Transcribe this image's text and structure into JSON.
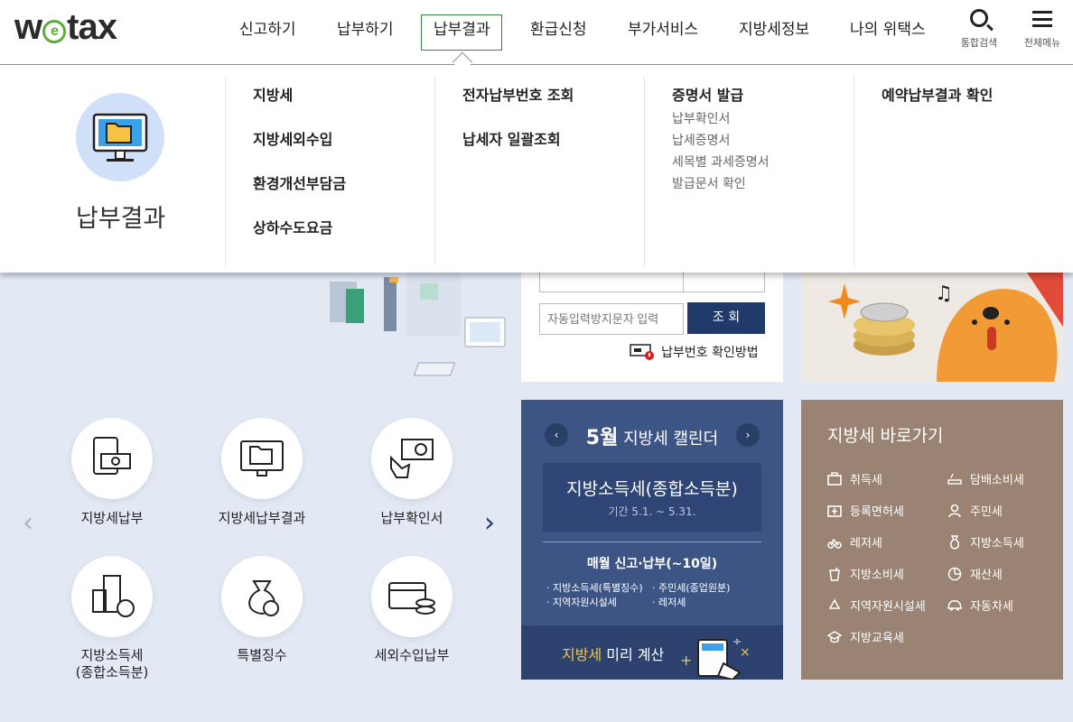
{
  "header": {
    "logo": "wetax",
    "nav": [
      "신고하기",
      "납부하기",
      "납부결과",
      "환급신청",
      "부가서비스",
      "지방세정보",
      "나의 위택스"
    ],
    "search_label": "통합검색",
    "menu_label": "전체메뉴"
  },
  "dropdown": {
    "title": "납부결과",
    "col1": [
      "지방세",
      "지방세외수입",
      "환경개선부담금",
      "상하수도요금"
    ],
    "col2": [
      "전자납부번호 조회",
      "납세자 일괄조회"
    ],
    "col3_head": "증명서 발급",
    "col3_subs": [
      "납부확인서",
      "납세증명서",
      "세목별 과세증명서",
      "발급문서 확인"
    ],
    "col4": [
      "예약납부결과 확인"
    ]
  },
  "lookup": {
    "captcha_placeholder": "자동입력방지문자 입력",
    "search_button": "조 회",
    "help_link": "납부번호 확인방법"
  },
  "calendar": {
    "month": "5월",
    "title_suffix": "지방세 캘린더",
    "card_title": "지방소득세(종합소득분)",
    "card_period": "기간 5.1. ~ 5.31.",
    "monthly": "매월 신고·납부(~10일)",
    "taxes": [
      "지방소득세(특별징수)",
      "주민세(종업원분)",
      "지역자원시설세",
      "레저세"
    ],
    "footer_hl": "지방세",
    "footer_rest": " 미리 계산"
  },
  "shortcuts": {
    "title": "지방세 바로가기",
    "items": [
      "취득세",
      "담배소비세",
      "등록면허세",
      "주민세",
      "레저세",
      "지방소득세",
      "지방소비세",
      "재산세",
      "지역자원시설세",
      "자동차세",
      "지방교육세"
    ]
  },
  "quick": {
    "items": [
      "지방세납부",
      "지방세납부결과",
      "납부확인서",
      "지방소득세",
      "(종합소득분)",
      "특별징수",
      "세외수입납부"
    ]
  },
  "colors": {
    "blue_panel": "#3d5585",
    "brown_panel": "#9b8373",
    "button": "#1f3a6b",
    "highlight": "#f5c342",
    "selection": "#2a8a3a"
  }
}
